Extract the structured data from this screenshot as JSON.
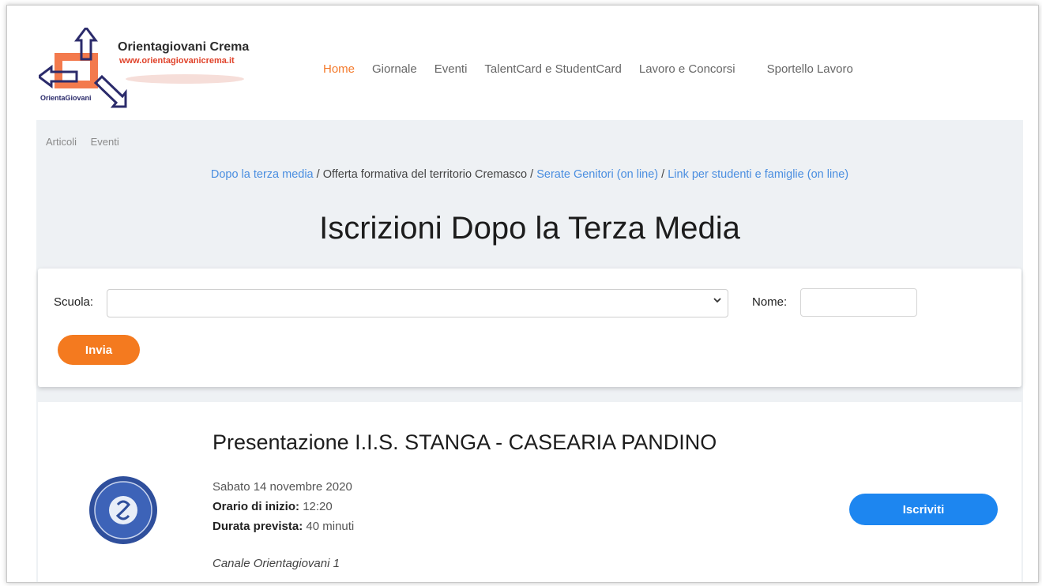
{
  "logo": {
    "title": "Orientagiovani Crema",
    "url": "www.orientagiovanicrema.it",
    "small": "OrientaGiovani"
  },
  "nav": {
    "items": [
      "Home",
      "Giornale",
      "Eventi",
      "TalentCard e StudentCard",
      "Lavoro e Concorsi",
      "Sportello Lavoro"
    ],
    "active": "Home"
  },
  "tabs": [
    "Articoli",
    "Eventi"
  ],
  "breadcrumb": {
    "item1": "Dopo la terza media",
    "sep": " / ",
    "item2": "Offerta formativa del territorio Cremasco",
    "item3": "Serate Genitori (on line)",
    "item4": "Link per studenti e famiglie (on line)"
  },
  "page_title": "Iscrizioni Dopo la Terza Media",
  "form": {
    "scuola_label": "Scuola:",
    "scuola_value": "",
    "nome_label": "Nome:",
    "nome_value": "",
    "submit_label": "Invia"
  },
  "event": {
    "title": "Presentazione I.I.S. STANGA - CASEARIA PANDINO",
    "date": "Sabato 14 novembre 2020",
    "start_label": "Orario di inizio:",
    "start_value": "12:20",
    "duration_label": "Durata prevista:",
    "duration_value": "40 minuti",
    "channel": "Canale Orientagiovani 1",
    "button_label": "Iscriviti"
  },
  "colors": {
    "accent_orange": "#f47a1f",
    "link_blue": "#4a8ee0",
    "button_blue": "#1d86f0",
    "band_grey": "#eef1f4"
  }
}
